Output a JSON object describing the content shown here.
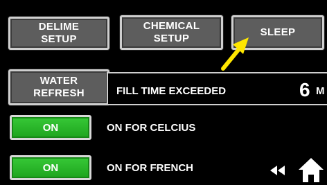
{
  "buttons": {
    "delime_setup": "DELIME\nSETUP",
    "chemical_setup": "CHEMICAL\nSETUP",
    "sleep": "SLEEP",
    "water_refresh": "WATER\nREFRESH"
  },
  "status": {
    "message": "FILL TIME EXCEEDED",
    "value": "6",
    "unit": "M"
  },
  "toggles": [
    {
      "state": "ON",
      "label": "ON FOR CELCIUS"
    },
    {
      "state": "ON",
      "label": "ON FOR FRENCH"
    }
  ],
  "icons": {
    "back": "rewind-icon",
    "home": "home-icon",
    "pointer": "arrow-pointer-icon"
  },
  "colors": {
    "on_green": "#2bb52b",
    "button_grey": "#5d5d5d",
    "arrow_yellow": "#ffe600"
  }
}
